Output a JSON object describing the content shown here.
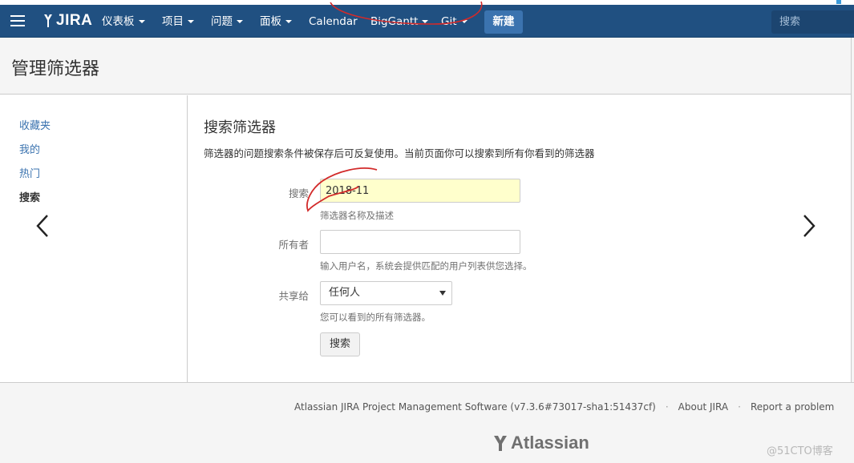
{
  "nav": {
    "logo": "JIRA",
    "items": [
      {
        "label": "仪表板",
        "dropdown": true
      },
      {
        "label": "项目",
        "dropdown": true
      },
      {
        "label": "问题",
        "dropdown": true
      },
      {
        "label": "面板",
        "dropdown": true
      },
      {
        "label": "Calendar",
        "dropdown": false
      },
      {
        "label": "BigGantt",
        "dropdown": true
      },
      {
        "label": "Git",
        "dropdown": true
      }
    ],
    "create_label": "新建",
    "search_placeholder": "搜索"
  },
  "page": {
    "title": "管理筛选器"
  },
  "sidebar": {
    "items": [
      {
        "label": "收藏夹",
        "active": false
      },
      {
        "label": "我的",
        "active": false
      },
      {
        "label": "热门",
        "active": false
      },
      {
        "label": "搜索",
        "active": true
      }
    ]
  },
  "main": {
    "heading": "搜索筛选器",
    "description": "筛选器的问题搜索条件被保存后可反复使用。当前页面你可以搜索到所有你看到的筛选器",
    "form": {
      "search_label": "搜索",
      "search_value": "2018-11",
      "search_help": "筛选器名称及描述",
      "owner_label": "所有者",
      "owner_value": "",
      "owner_help": "输入用户名，系统会提供匹配的用户列表供您选择。",
      "share_label": "共享给",
      "share_value": "任何人",
      "share_help": "您可以看到的所有筛选器。",
      "submit_label": "搜索"
    }
  },
  "footer": {
    "version": "Atlassian JIRA Project Management Software (v7.3.6#73017-sha1:51437cf)",
    "about": "About JIRA",
    "report": "Report a problem",
    "atlassian_logo": "Atlassian",
    "watermark": "@51CTO博客"
  },
  "colors": {
    "nav_bg": "#205081",
    "create_btn": "#3b73af",
    "link": "#3b73af",
    "highlight_input": "#ffffcc",
    "annotation": "#d22a2a"
  }
}
